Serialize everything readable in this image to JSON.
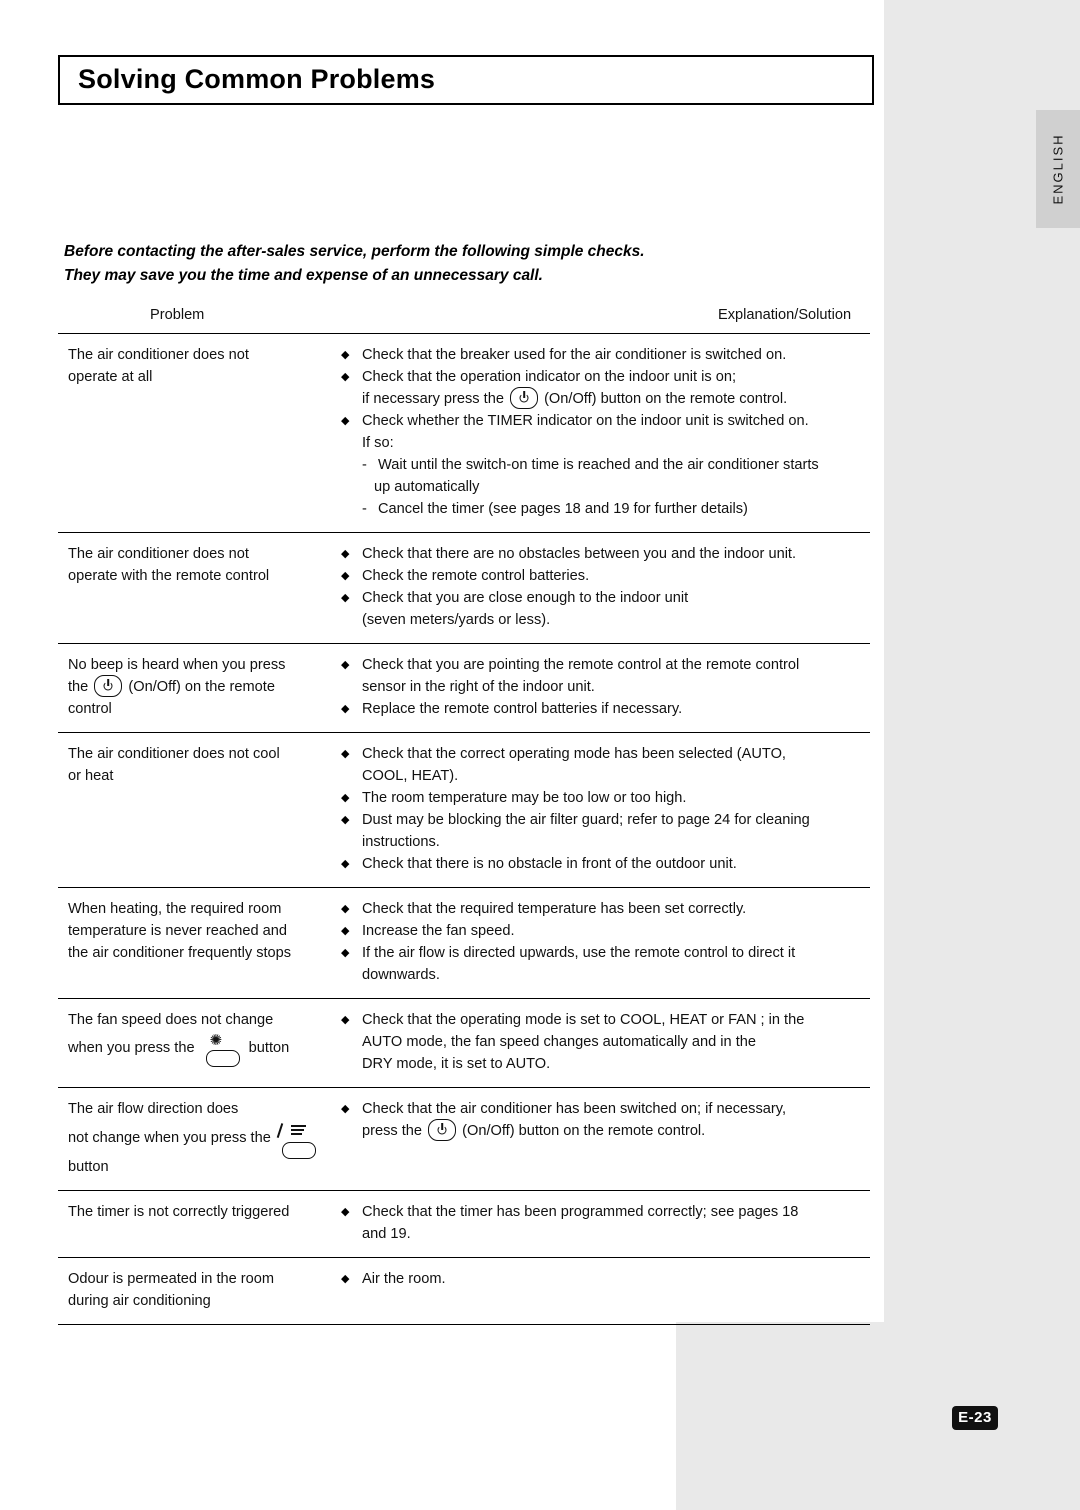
{
  "page": {
    "title": "Solving Common Problems",
    "side_tab": "ENGLISH",
    "page_number": "E-23"
  },
  "intro": {
    "line1": "Before contacting the after-sales service, perform the following simple checks.",
    "line2": "They may save you the time and expense of an unnecessary call."
  },
  "table": {
    "headers": {
      "problem": "Problem",
      "solution": "Explanation/Solution"
    },
    "rows": [
      {
        "problem_lines": [
          "The air conditioner does not",
          "operate at all"
        ],
        "solution_lines": [
          {
            "type": "bullet",
            "text": "Check that the breaker used for the air conditioner is switched on."
          },
          {
            "type": "bullet",
            "text": "Check that the operation indicator on the indoor unit is on;"
          },
          {
            "type": "icon-power",
            "pre": "if necessary press the",
            "post": "(On/Off) button on the remote control."
          },
          {
            "type": "bullet",
            "text": "Check whether the TIMER indicator on the indoor unit is switched on."
          },
          {
            "type": "plain",
            "text": "If so:"
          },
          {
            "type": "dash",
            "text": "Wait until the switch-on time is reached and the air conditioner starts"
          },
          {
            "type": "cont",
            "text": "up automatically"
          },
          {
            "type": "dash",
            "text": "Cancel the timer (see pages 18 and 19 for further details)"
          }
        ]
      },
      {
        "problem_lines": [
          "The air conditioner does not",
          "operate with the remote control"
        ],
        "solution_lines": [
          {
            "type": "bullet",
            "text": "Check that there are no obstacles between you and the indoor unit."
          },
          {
            "type": "bullet",
            "text": "Check the remote control batteries."
          },
          {
            "type": "bullet",
            "text": "Check that you are close enough to the indoor unit"
          },
          {
            "type": "plain",
            "text": "(seven meters/yards or less)."
          }
        ]
      },
      {
        "problem_lines": [
          "No beep is heard when you press"
        ],
        "problem_icon": {
          "type": "power",
          "pre": "the",
          "post": "(On/Off) on the remote"
        },
        "problem_lines_after": [
          "control"
        ],
        "solution_lines": [
          {
            "type": "bullet",
            "text": "Check that you are pointing the remote control at the remote control"
          },
          {
            "type": "plain",
            "text": "sensor in the right of the indoor unit."
          },
          {
            "type": "bullet",
            "text": "Replace the remote control batteries if necessary."
          }
        ]
      },
      {
        "problem_lines": [
          "The air conditioner does not cool",
          "or heat"
        ],
        "solution_lines": [
          {
            "type": "bullet",
            "text": "Check that the correct operating mode has been selected (AUTO,"
          },
          {
            "type": "plain",
            "text": "COOL, HEAT)."
          },
          {
            "type": "bullet",
            "text": "The room temperature may be too low or too high."
          },
          {
            "type": "bullet",
            "text": "Dust may be blocking the air filter guard; refer to page 24 for cleaning"
          },
          {
            "type": "plain",
            "text": "instructions."
          },
          {
            "type": "bullet",
            "text": "Check that there is no obstacle in front of the outdoor unit."
          }
        ]
      },
      {
        "problem_lines": [
          "When heating, the required room",
          "temperature is never reached and",
          "the air conditioner frequently stops"
        ],
        "solution_lines": [
          {
            "type": "bullet",
            "text": "Check that the required temperature has been set correctly."
          },
          {
            "type": "bullet",
            "text": "Increase the fan speed."
          },
          {
            "type": "bullet",
            "text": "If the air flow is directed upwards, use the remote control to direct it"
          },
          {
            "type": "plain",
            "text": "downwards."
          }
        ]
      },
      {
        "problem_lines": [
          "The fan speed does not change"
        ],
        "problem_icon": {
          "type": "fan",
          "pre": "when you press the",
          "post": "button"
        },
        "solution_lines": [
          {
            "type": "bullet",
            "text": "Check that the operating mode is set to COOL, HEAT or FAN ; in the"
          },
          {
            "type": "plain",
            "text": "AUTO mode, the fan speed changes automatically and in the"
          },
          {
            "type": "plain",
            "text": "DRY mode, it is set to AUTO."
          }
        ]
      },
      {
        "problem_lines": [
          "The air flow direction does"
        ],
        "problem_icon": {
          "type": "swing",
          "pre": "not change when you press the",
          "post": ""
        },
        "problem_lines_after": [
          "button"
        ],
        "solution_lines": [
          {
            "type": "bullet",
            "text": "Check that the air conditioner has been switched on; if necessary,"
          },
          {
            "type": "icon-power",
            "pre": "press the",
            "post": "(On/Off) button on the remote control."
          }
        ]
      },
      {
        "problem_lines": [
          "The timer is not correctly triggered"
        ],
        "solution_lines": [
          {
            "type": "bullet",
            "text": "Check that the timer has been programmed correctly; see pages 18"
          },
          {
            "type": "plain",
            "text": "and 19."
          }
        ]
      },
      {
        "problem_lines": [
          "Odour is permeated in the room",
          "during air conditioning"
        ],
        "solution_lines": [
          {
            "type": "bullet",
            "text": "Air the room."
          }
        ]
      }
    ]
  }
}
